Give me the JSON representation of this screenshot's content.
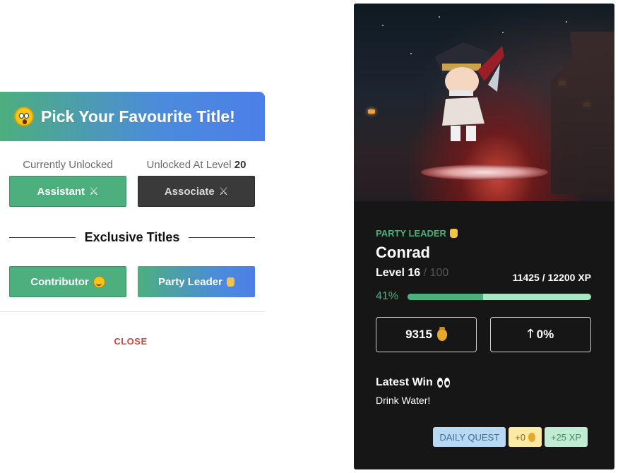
{
  "modal": {
    "title": "Pick Your Favourite Title!",
    "currently_unlocked_label": "Currently Unlocked",
    "unlocked_at_level_label": "Unlocked At Level",
    "unlocked_at_level_value": "20",
    "current_title": {
      "label": "Assistant",
      "icon": "crossed-swords-icon"
    },
    "next_title": {
      "label": "Associate",
      "icon": "crossed-swords-icon"
    },
    "exclusive_heading": "Exclusive Titles",
    "exclusive_titles": [
      {
        "label": "Contributor",
        "icon": "hugging-face-icon"
      },
      {
        "label": "Party Leader",
        "icon": "raised-fist-icon"
      }
    ],
    "close_label": "CLOSE"
  },
  "profile": {
    "rank": "PARTY LEADER",
    "name": "Conrad",
    "level_label": "Level 16",
    "level_max": "/ 100",
    "xp": "11425 / 12200 XP",
    "progress_percent_label": "41%",
    "progress_fraction": 0.41,
    "coins": "9315",
    "growth": "0%",
    "latest_win_label": "Latest Win",
    "latest_win_text": "Drink Water!",
    "chips": {
      "type": "DAILY QUEST",
      "coins": "+0",
      "xp": "+25 XP"
    }
  },
  "colors": {
    "accent_green": "#4caf7d",
    "accent_blue": "#4c7fe8",
    "close_red": "#d9443a",
    "card_bg": "#161616"
  }
}
